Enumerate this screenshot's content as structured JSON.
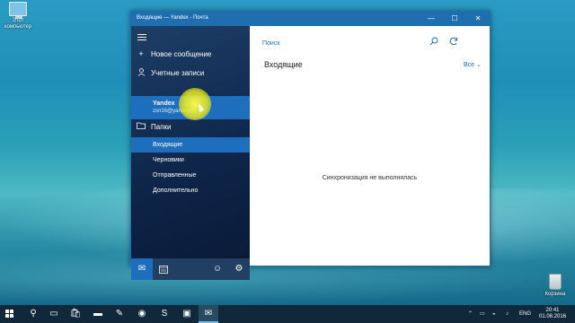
{
  "desktop": {
    "this_pc_label": "Этот компьютер",
    "recycle_bin_label": "Корзина"
  },
  "window": {
    "title": "Входящие — Yandex - Почта",
    "minimize_glyph": "—",
    "maximize_glyph": "☐",
    "close_glyph": "✕"
  },
  "sidebar": {
    "new_message": "Новое сообщение",
    "accounts": "Учетные записи",
    "account_name": "Yandex",
    "account_email": "zsn16@yandex.ru",
    "folders_label": "Папки",
    "folders": [
      "Входящие",
      "Черновики",
      "Отправленные",
      "Дополнительно"
    ],
    "active_folder": "Входящие"
  },
  "bottom_bar": {
    "icons": [
      "mail-icon",
      "calendar-icon",
      "smiley-icon",
      "gear-icon"
    ],
    "active": "mail-icon"
  },
  "main": {
    "search_placeholder": "Поиск",
    "inbox_title": "Входящие",
    "filter_label": "Все",
    "empty_message": "Синхронизация не выполнялась"
  },
  "taskbar": {
    "language": "ENG",
    "time": "20:41",
    "date": "01.08.2016"
  },
  "colors": {
    "accent": "#1d6fbd",
    "titlebar": "#1f6fb0",
    "taskbar": "#10283a"
  }
}
